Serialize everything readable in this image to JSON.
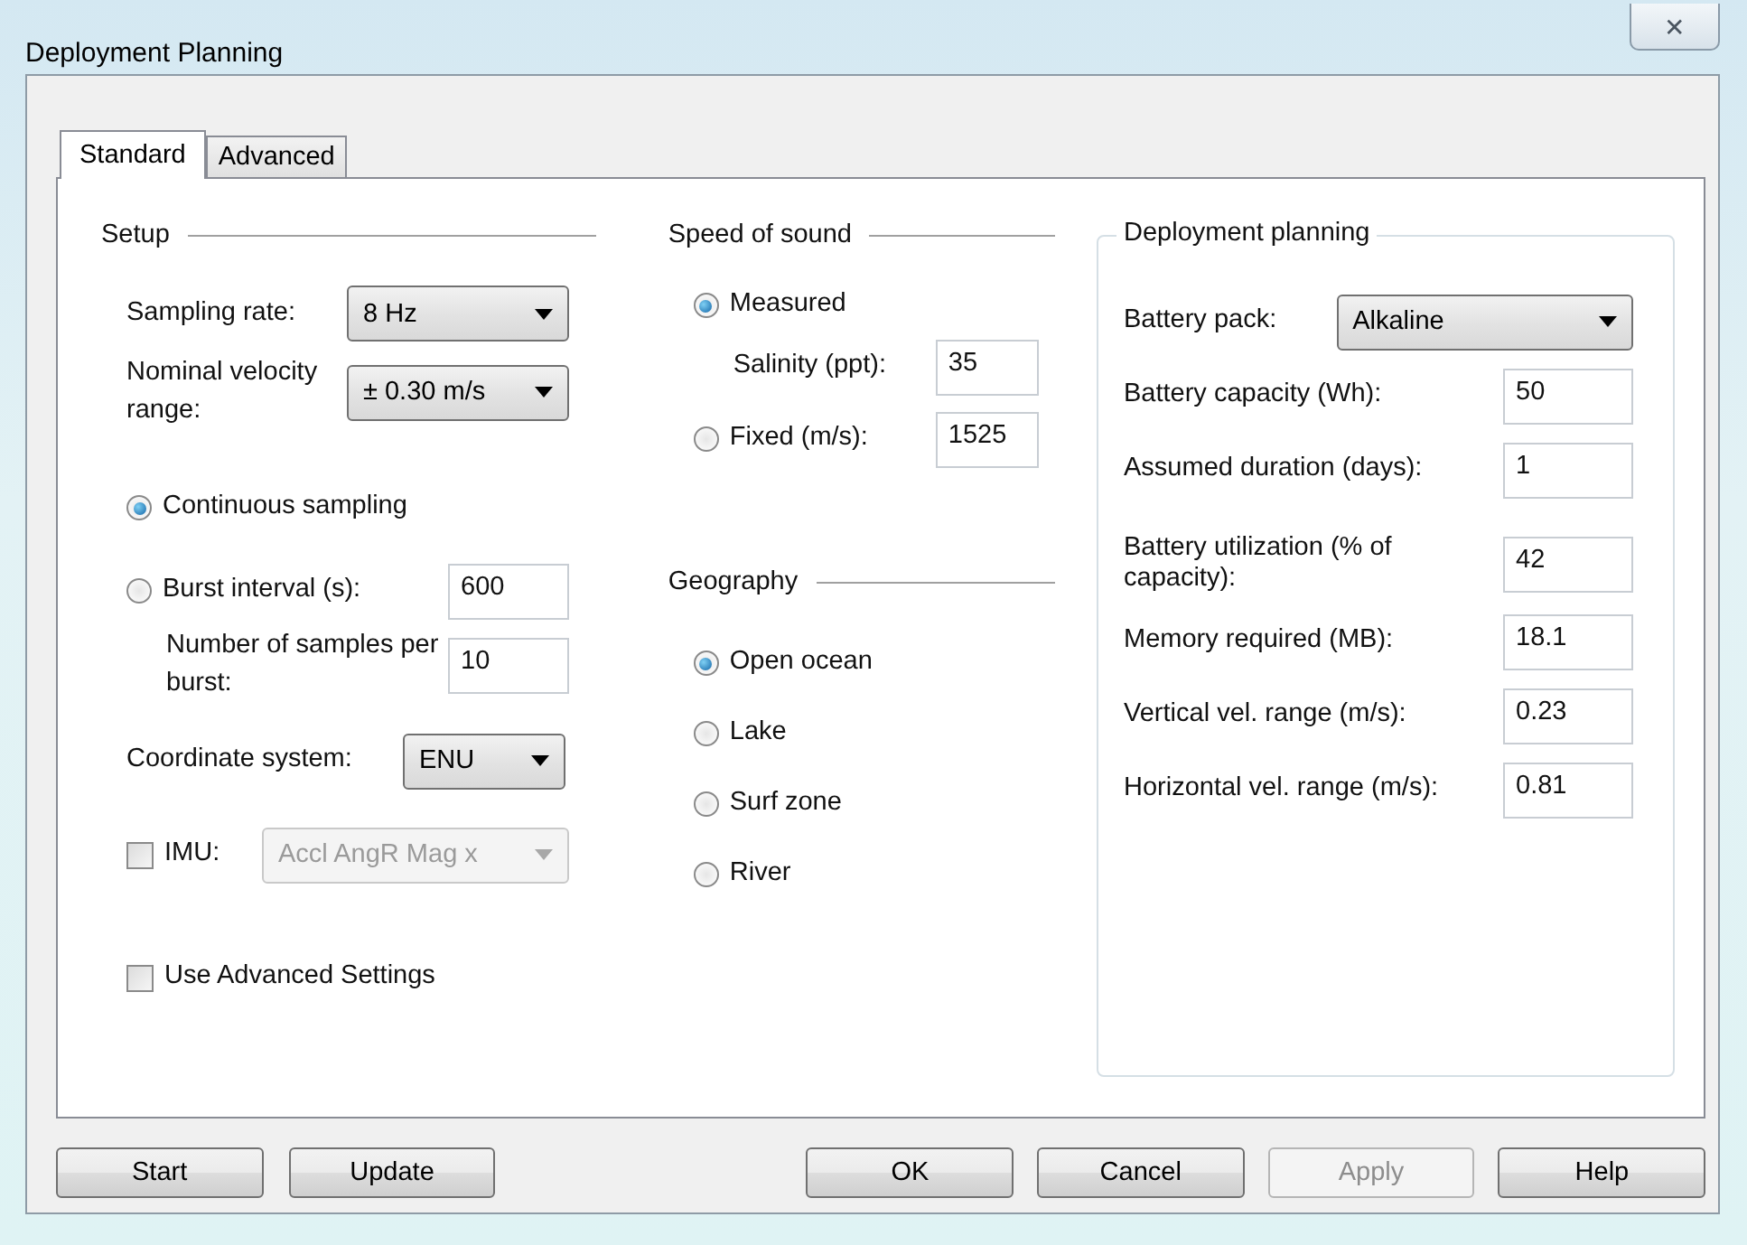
{
  "window": {
    "title": "Deployment Planning",
    "close": "✕"
  },
  "tabs": [
    {
      "label": "Standard",
      "selected": true
    },
    {
      "label": "Advanced",
      "selected": false
    }
  ],
  "setup": {
    "title": "Setup",
    "sampling_rate": {
      "label": "Sampling rate:",
      "value": "8 Hz"
    },
    "velocity_range": {
      "label": "Nominal velocity range:",
      "value": "± 0.30 m/s"
    },
    "modes": [
      {
        "label": "Continuous sampling",
        "selected": true
      },
      {
        "label": "Burst interval (s):",
        "selected": false,
        "value": "600"
      }
    ],
    "samples_per_burst": {
      "label": "Number of samples per burst:",
      "value": "10"
    },
    "coordinate_system": {
      "label": "Coordinate system:",
      "value": "ENU"
    },
    "imu": {
      "label": "IMU:",
      "checked": false,
      "value": "Accl AngR Mag x",
      "disabled": true
    },
    "advanced_settings": {
      "label": "Use Advanced Settings",
      "checked": false
    }
  },
  "speed_of_sound": {
    "title": "Speed of sound",
    "options": [
      {
        "label": "Measured",
        "selected": true
      },
      {
        "label": "Fixed (m/s):",
        "selected": false,
        "value": "1525"
      }
    ],
    "salinity": {
      "label": "Salinity (ppt):",
      "value": "35"
    }
  },
  "geography": {
    "title": "Geography",
    "options": [
      {
        "label": "Open ocean",
        "selected": true
      },
      {
        "label": "Lake",
        "selected": false
      },
      {
        "label": "Surf zone",
        "selected": false
      },
      {
        "label": "River",
        "selected": false
      }
    ]
  },
  "deployment_planning": {
    "title": "Deployment planning",
    "battery_pack": {
      "label": "Battery pack:",
      "value": "Alkaline"
    },
    "fields": [
      {
        "label": "Battery capacity (Wh):",
        "value": "50"
      },
      {
        "label": "Assumed duration (days):",
        "value": "1"
      },
      {
        "label": "Battery utilization (% of capacity):",
        "value": "42"
      },
      {
        "label": "Memory required (MB):",
        "value": "18.1"
      },
      {
        "label": "Vertical vel. range (m/s):",
        "value": "0.23"
      },
      {
        "label": "Horizontal vel. range (m/s):",
        "value": "0.81"
      }
    ]
  },
  "buttons_left": [
    {
      "label": "Start",
      "disabled": false
    },
    {
      "label": "Update",
      "disabled": false
    }
  ],
  "buttons_right": [
    {
      "label": "OK",
      "disabled": false
    },
    {
      "label": "Cancel",
      "disabled": false
    },
    {
      "label": "Apply",
      "disabled": true
    },
    {
      "label": "Help",
      "disabled": false
    }
  ]
}
